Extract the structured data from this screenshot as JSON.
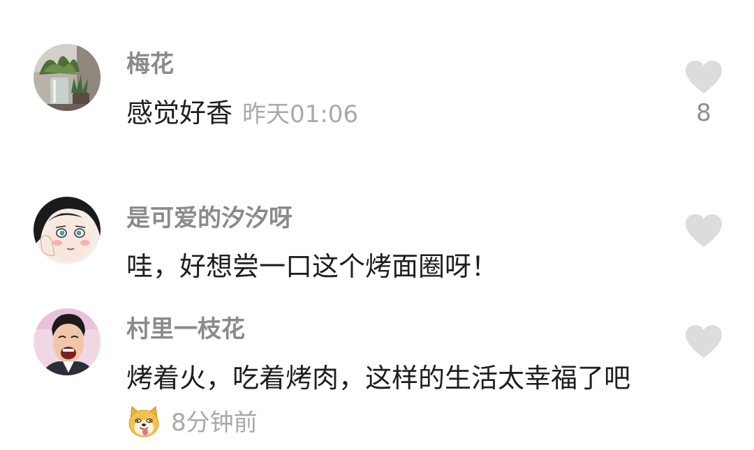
{
  "comments": [
    {
      "username": "梅花",
      "text": "感觉好香",
      "time": "昨天01:06",
      "likes": "8",
      "avatar_icon": "flower-pot-photo"
    },
    {
      "username": "是可爱的汐汐呀",
      "text": "哇，好想尝一口这个烤面圈呀！",
      "time": "",
      "likes": "",
      "avatar_icon": "anime-girl-portrait"
    },
    {
      "username": "村里一枝花",
      "text": "烤着火，吃着烤肉，这样的生活太幸福了吧",
      "emoji": "doge-emoji",
      "time": "8分钟前",
      "likes": "",
      "avatar_icon": "laughing-man-photo"
    }
  ],
  "colors": {
    "username": "#8a8a8a",
    "body_text": "#1e1e1e",
    "timestamp": "#a9a9a9",
    "heart": "#dcdcdc"
  }
}
